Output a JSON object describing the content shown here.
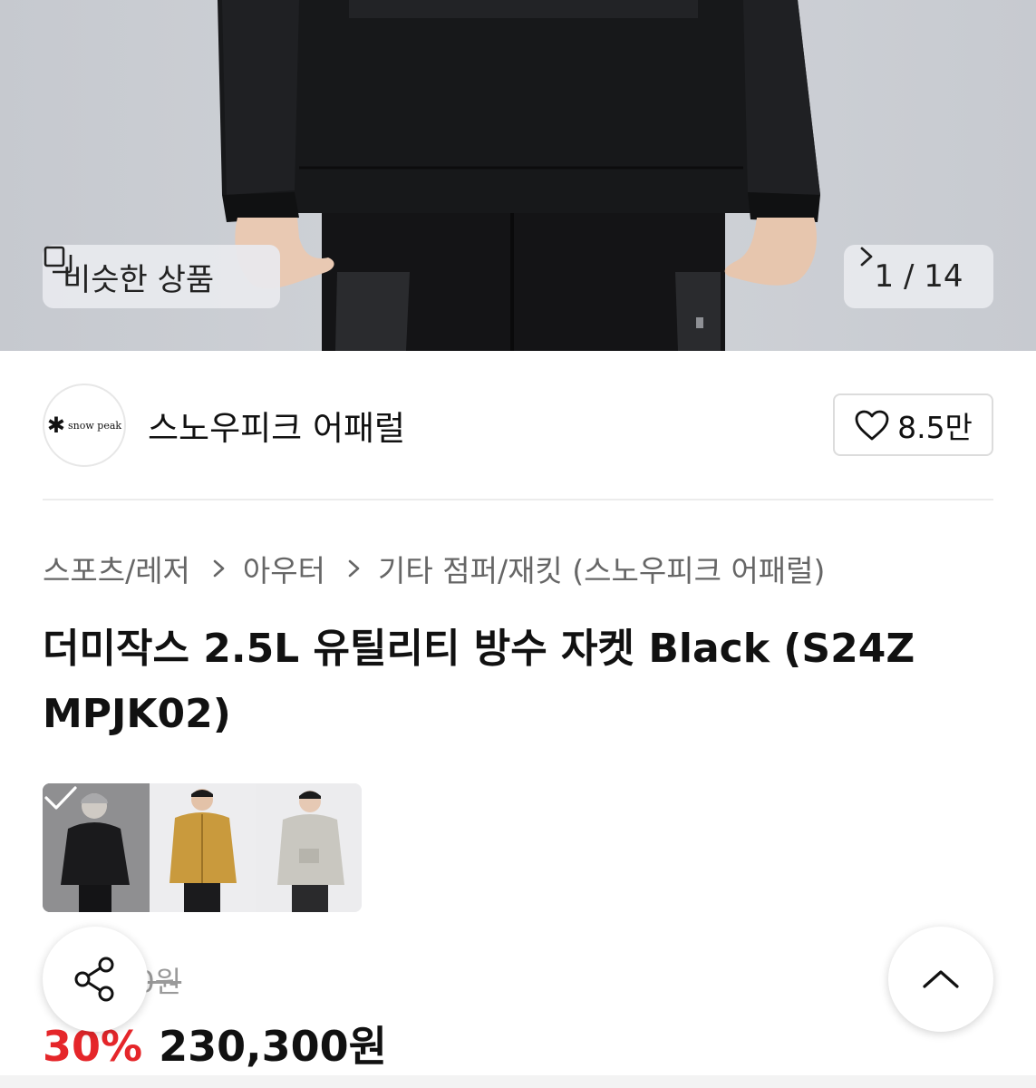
{
  "hero": {
    "similar_label": "비슷한 상품",
    "counter": "1 / 14"
  },
  "seller": {
    "logo_text": "snow peak",
    "name": "스노우피크 어패럴",
    "likes": "8.5만"
  },
  "breadcrumb": [
    "스포츠/레저",
    "아우터",
    "기타 점퍼/재킷 (스노우피크 어패럴)"
  ],
  "product": {
    "title": "더미작스 2.5L 유틸리티 방수 자켓 Black (S24ZMPJK02)",
    "title_line1": "더미작스 2.5L 유틸리티 방수 자켓 Black (S24Z",
    "title_line2": "MPJK02)",
    "original_price_visible": "00원",
    "discount": "30%",
    "price": "230,300원"
  },
  "color_options": [
    {
      "color": "Black",
      "hex": "#1c1c1e",
      "selected": true
    },
    {
      "color": "Mustard",
      "hex": "#c99a3d",
      "selected": false
    },
    {
      "color": "Light Gray",
      "hex": "#c9c7c0",
      "selected": false
    }
  ],
  "icons": {
    "similar": "squares-icon",
    "counter_next": "chevron-right-icon",
    "like": "heart-icon",
    "share": "share-icon",
    "scroll_top": "chevron-up-icon",
    "selected": "check-icon"
  },
  "colors": {
    "discount": "#e5262a",
    "text": "#111111",
    "muted": "#666666"
  }
}
